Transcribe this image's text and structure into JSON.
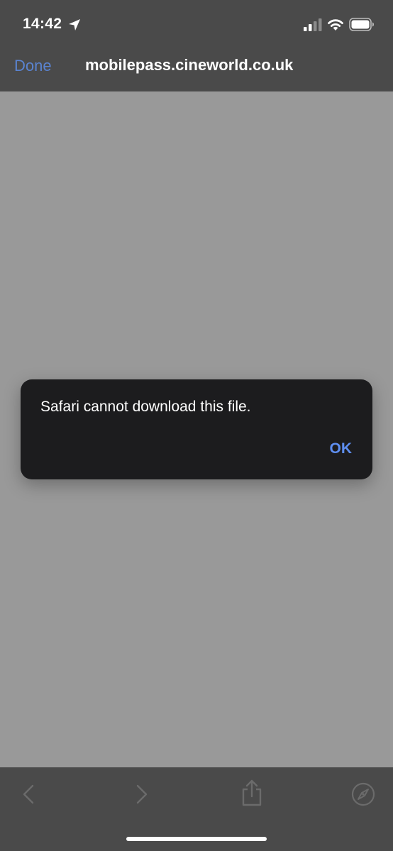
{
  "status_bar": {
    "time": "14:42",
    "location_icon": "location-arrow-icon",
    "signal_icon": "cellular-signal-icon",
    "wifi_icon": "wifi-icon",
    "battery_icon": "battery-icon"
  },
  "nav": {
    "done_label": "Done",
    "title": "mobilepass.cineworld.co.uk"
  },
  "alert": {
    "message": "Safari cannot download this file.",
    "ok_label": "OK"
  },
  "toolbar": {
    "items": [
      "back-chevron-icon",
      "forward-chevron-icon",
      "share-icon",
      "compass-icon"
    ]
  },
  "colors": {
    "header_bg": "#4a4a4a",
    "content_bg": "#999999",
    "alert_bg": "#1c1c1e",
    "accent": "#5e8ef0",
    "done_accent": "#5a83d0"
  }
}
